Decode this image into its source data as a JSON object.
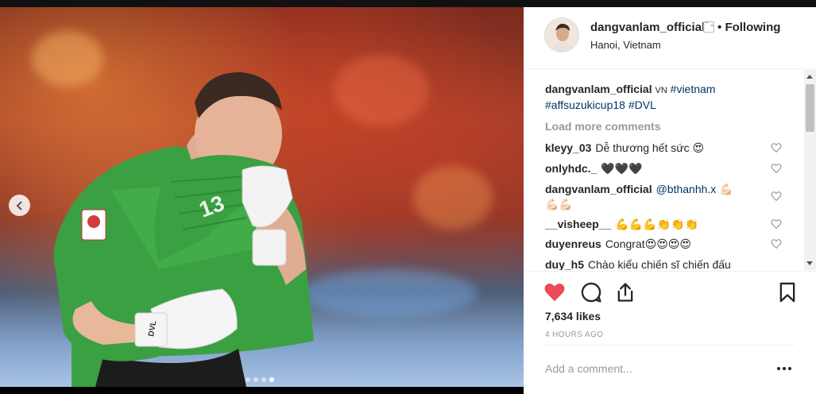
{
  "post": {
    "username": "dangvanlam_official",
    "follow_separator": "•",
    "follow_status": "Following",
    "location": "Hanoi, Vietnam",
    "verified_glyph": "⌃⌄"
  },
  "caption": {
    "username": "dangvanlam_official",
    "lang": "VN",
    "tag1": "#vietnam",
    "tag2": "#affsuzukicup18",
    "tag3": "#DVL"
  },
  "load_more": "Load more comments",
  "comments": [
    {
      "user": "kleyy_03",
      "text": "Dễ thương hết sức 😍"
    },
    {
      "user": "onlyhdc._",
      "text": "🖤🖤🖤"
    },
    {
      "user": "dangvanlam_official",
      "mention": "@bthanhh.x",
      "text": "💪🏻",
      "text2": "💪🏻💪🏻"
    },
    {
      "user": "__visheep__",
      "text": "💪💪💪👏👏👏"
    },
    {
      "user": "duyenreus",
      "text": "Congrat😍😍😍😍"
    },
    {
      "user": "duy_h5",
      "text": "Chào kiểu chiến sĩ chiến đấu"
    }
  ],
  "likes": "7,634 likes",
  "timestamp": "4 HOURS AGO",
  "add_comment_placeholder": "Add a comment...",
  "photo": {
    "jersey_number": "13",
    "glove_text": "DVL",
    "carousel_count": 4,
    "carousel_active": 3
  },
  "colors": {
    "like_red": "#ed4956",
    "tag_blue": "#003569",
    "jersey_green": "#3aa041"
  },
  "icons": [
    "chevron-left-icon",
    "heart-icon",
    "comment-icon",
    "share-icon",
    "bookmark-icon",
    "more-icon"
  ]
}
